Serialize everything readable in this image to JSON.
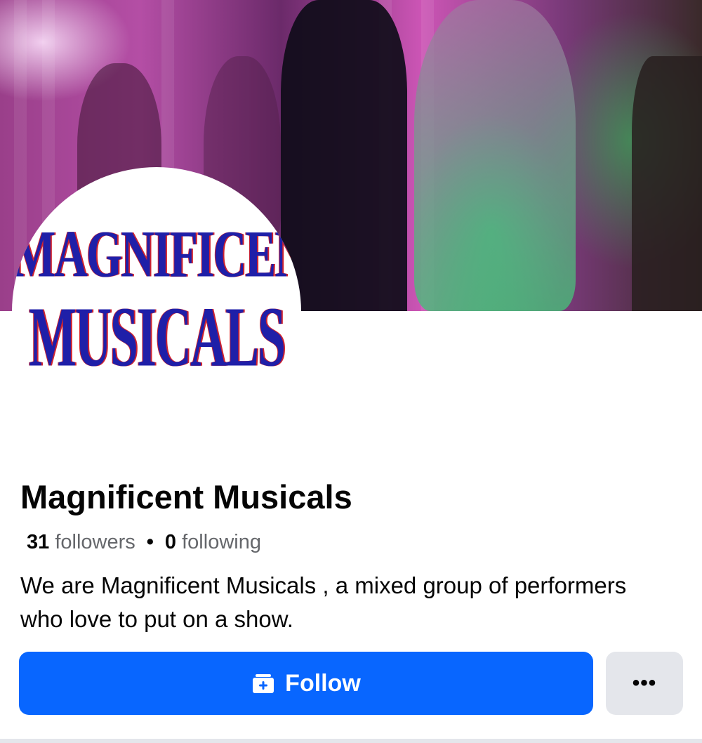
{
  "cover": {
    "logo_line1": "MAGNIFICENT",
    "logo_line2": "MUSICALS"
  },
  "profile": {
    "name": "Magnificent Musicals",
    "followers_count": "31",
    "followers_label": "followers",
    "separator": "•",
    "following_count": "0",
    "following_label": "following",
    "bio": "We are Magnificent Musicals , a mixed group of performers who love to put on a show."
  },
  "actions": {
    "follow_label": "Follow",
    "more_label": "•••"
  },
  "colors": {
    "primary": "#0866ff",
    "secondary_button": "#e4e6eb",
    "text": "#050505",
    "muted_text": "#65676b",
    "logo_blue": "#1f1fa8",
    "logo_red": "#d0232f"
  },
  "icons": {
    "follow": "follow-icon",
    "more": "more-dots-icon"
  }
}
